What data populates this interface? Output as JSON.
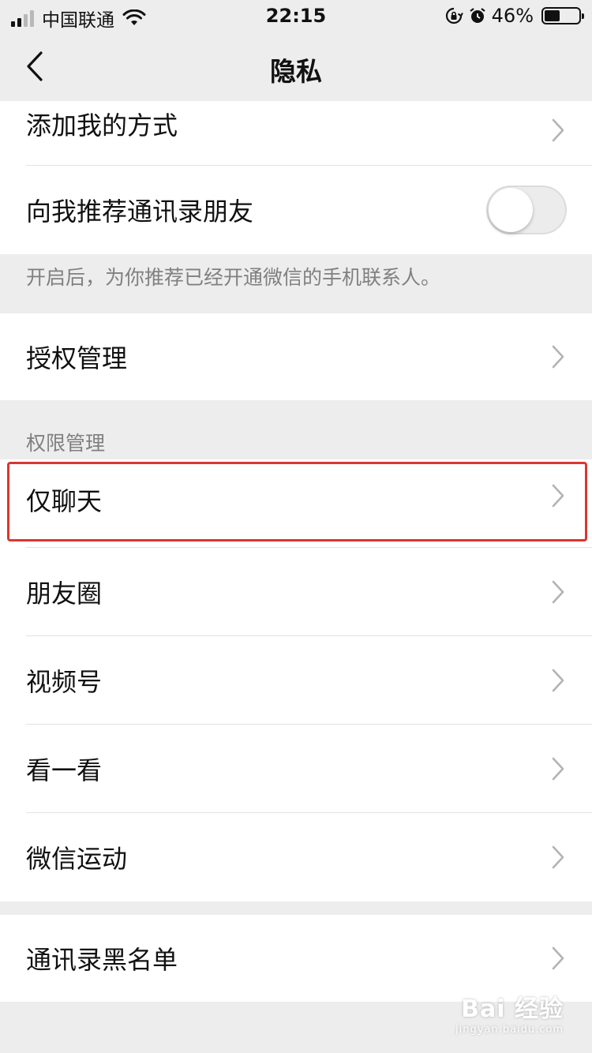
{
  "status_bar": {
    "carrier": "中国联通",
    "time": "22:15",
    "battery": "46%",
    "battery_level": 0.46
  },
  "nav": {
    "title": "隐私"
  },
  "top_group": {
    "add_me_label": "添加我的方式",
    "recommend_label": "向我推荐通讯录朋友",
    "recommend_enabled": false
  },
  "hint": "开启后，为你推荐已经开通微信的手机联系人。",
  "auth": {
    "label": "授权管理"
  },
  "permissions": {
    "header": "权限管理",
    "items": [
      {
        "label": "仅聊天"
      },
      {
        "label": "朋友圈"
      },
      {
        "label": "视频号"
      },
      {
        "label": "看一看"
      },
      {
        "label": "微信运动"
      }
    ]
  },
  "blacklist": {
    "label": "通讯录黑名单"
  },
  "watermark": {
    "main": "Bai 经验",
    "sub": "jingyan.baidu.com"
  },
  "colors": {
    "background": "#ededed",
    "highlight": "#d9372f",
    "hint_text": "#808080"
  }
}
